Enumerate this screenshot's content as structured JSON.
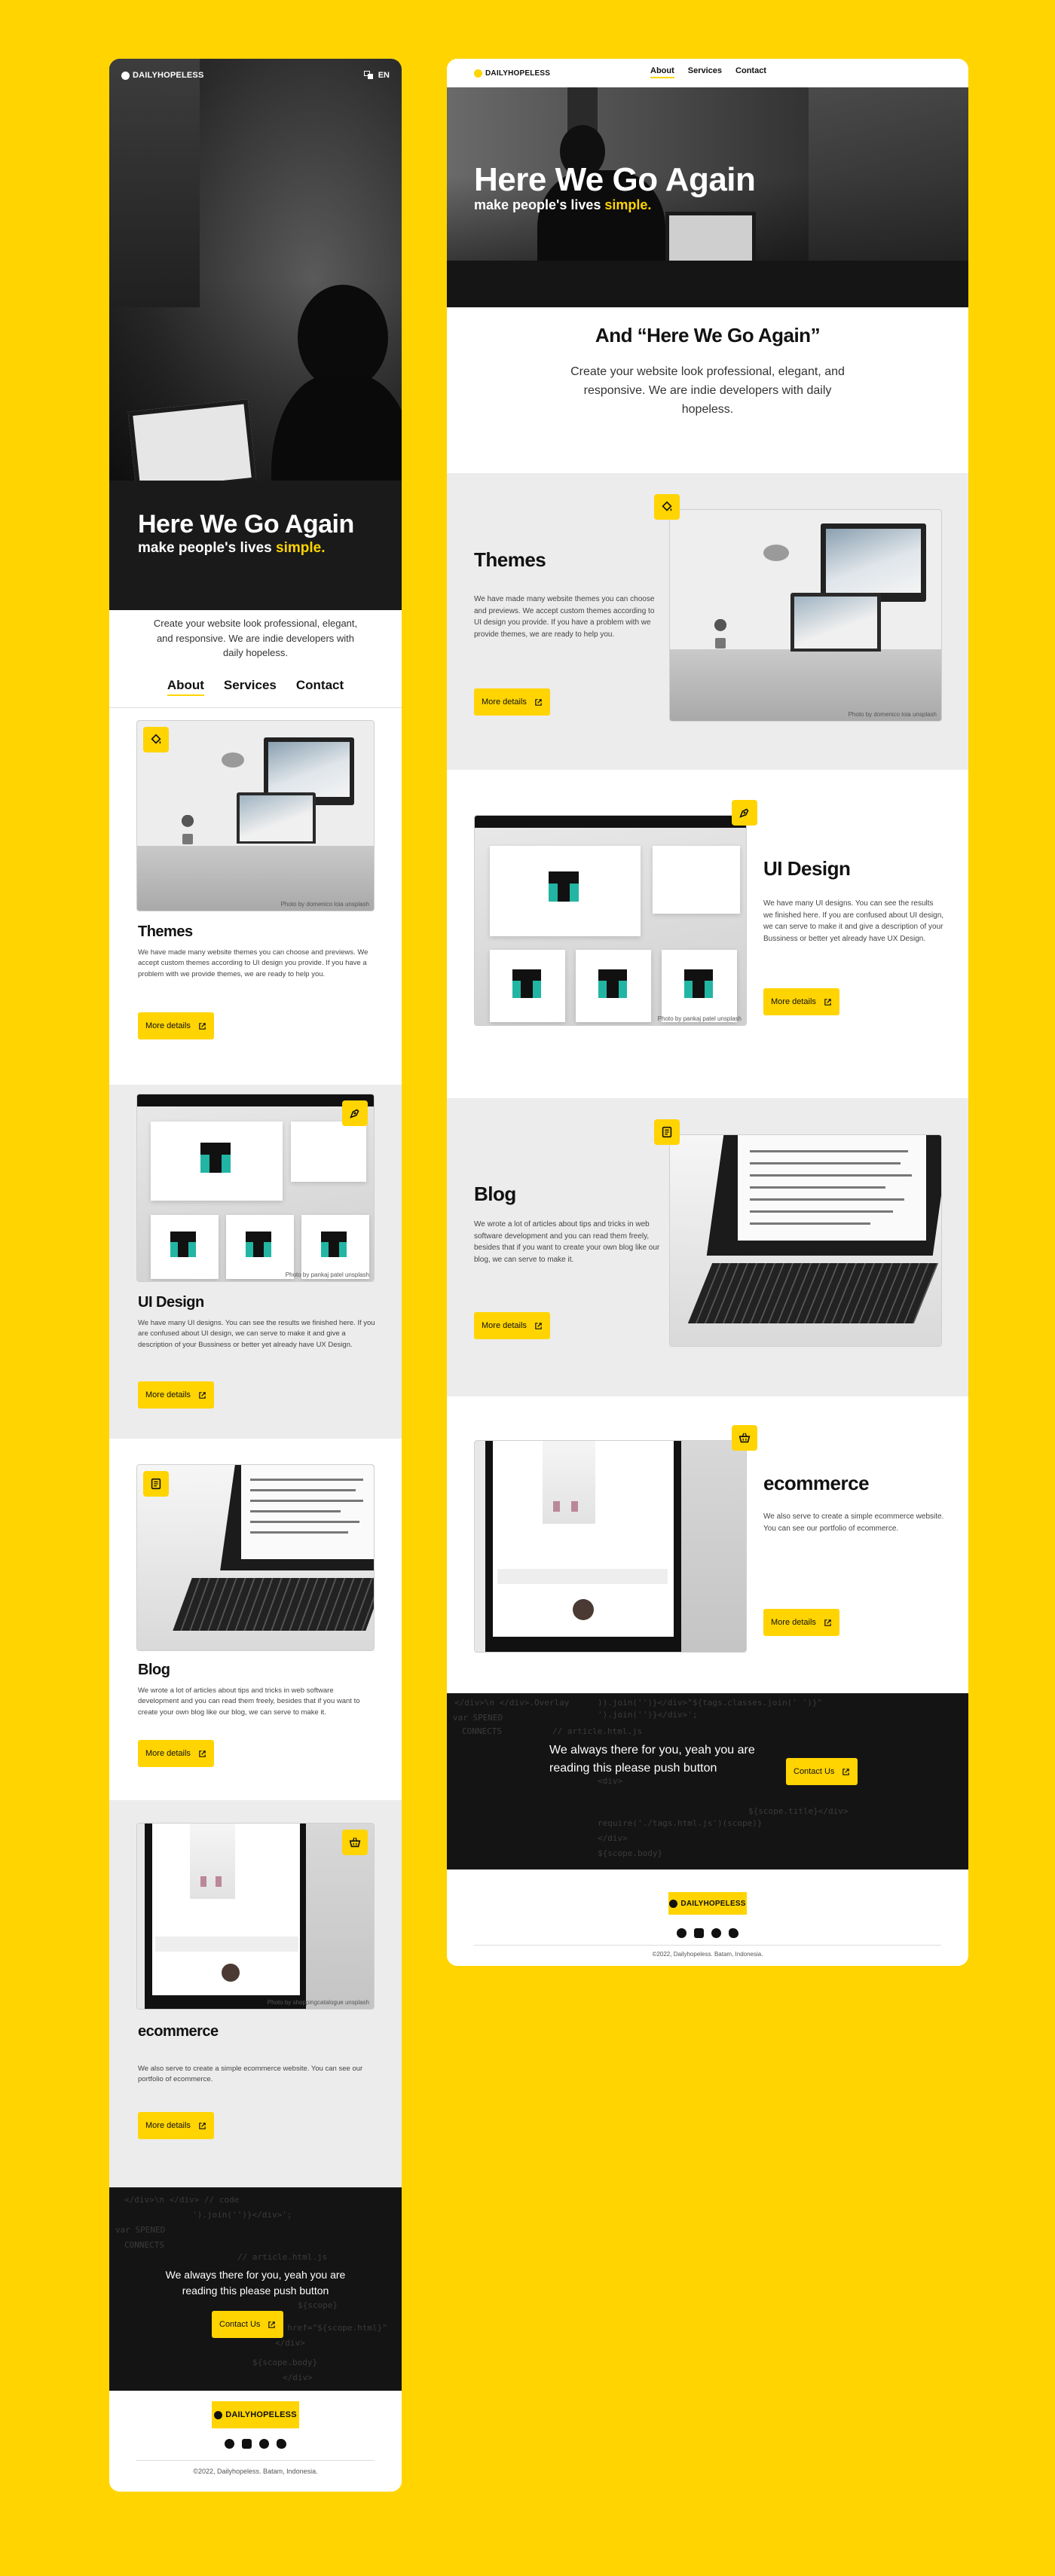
{
  "brand": {
    "name": "DAILYHOPELESS",
    "lang": "EN",
    "accent": "#FFD400"
  },
  "hero": {
    "title": "Here We Go Again",
    "subtitle_prefix": "make people's lives ",
    "subtitle_highlight": "simple.",
    "tagline_mobile": "Create your website look professional, elegant, and responsive. We are indie developers with daily hopeless."
  },
  "nav": {
    "about": "About",
    "services": "Services",
    "contact": "Contact"
  },
  "intro": {
    "heading": "And “Here We Go Again”",
    "text": "Create your website look professional, elegant, and responsive. We are indie developers with daily hopeless."
  },
  "services": [
    {
      "title": "Themes",
      "text": "We have made many website themes you can choose and previews. We accept custom themes according to UI design you provide. If you have a problem with  we provide themes, we are ready to help you.",
      "credit": "Photo by domenico loia unsplash",
      "button": "More details",
      "icon": "paint-bucket-icon"
    },
    {
      "title": "UI Design",
      "text": "We have many UI designs. You can see the results we finished here. If you are confused about UI design, we can serve to make it and give a description of your Bussiness or better yet already have UX Design.",
      "credit": "Photo by pankaj patel unsplash",
      "button": "More details",
      "icon": "pen-nib-icon"
    },
    {
      "title": "Blog",
      "text": "We wrote a lot of articles about tips and tricks in web software development and you can read them freely, besides that if you want to create your own blog like our blog, we can serve to make it.",
      "credit": "",
      "button": "More details",
      "icon": "document-icon"
    },
    {
      "title": "ecommerce",
      "text": "We also serve to create a simple ecommerce website. You can see our portfolio of ecommerce.",
      "credit": "Photo by shoppingcatalogue unsplash",
      "button": "More details",
      "icon": "basket-icon"
    }
  ],
  "cta": {
    "text": "We always there for you,  yeah you are reading this please push button",
    "button": "Contact Us"
  },
  "footer": {
    "copyright": "©2022, Dailyhopeless. Batam, Indonesia."
  }
}
